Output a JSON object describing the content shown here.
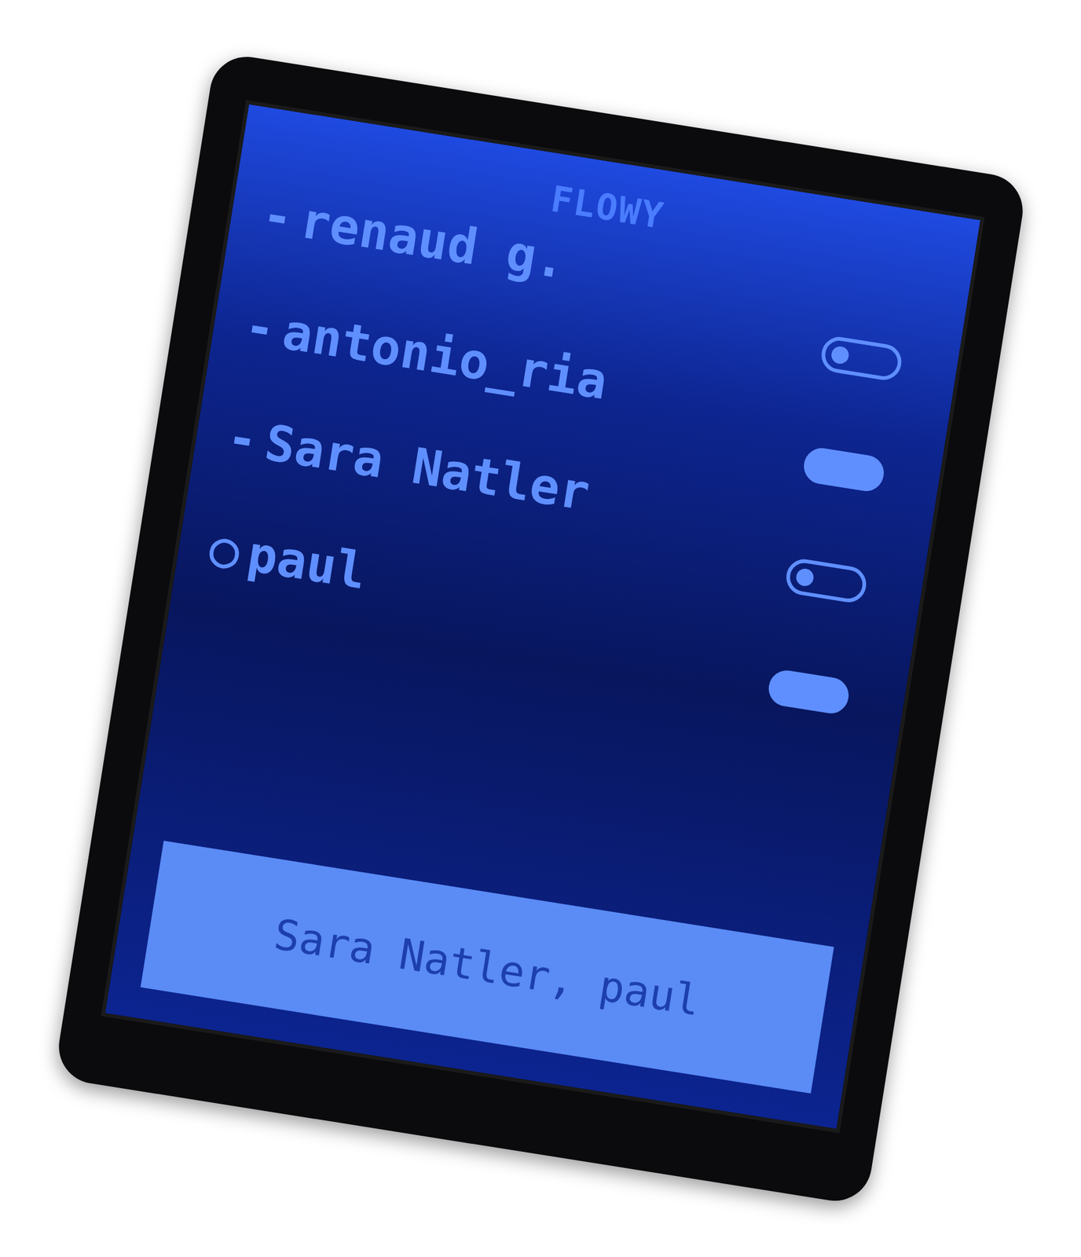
{
  "title": "FLOWY",
  "contacts": [
    {
      "marker": "-",
      "name": "renaud g.",
      "on": false
    },
    {
      "marker": "-",
      "name": "antonio_ria",
      "on": true
    },
    {
      "marker": "-",
      "name": "Sara Natler",
      "on": false
    },
    {
      "marker": "○",
      "name": "paul",
      "on": true
    }
  ],
  "selection_bar": {
    "text": "Sara Natler, paul"
  }
}
